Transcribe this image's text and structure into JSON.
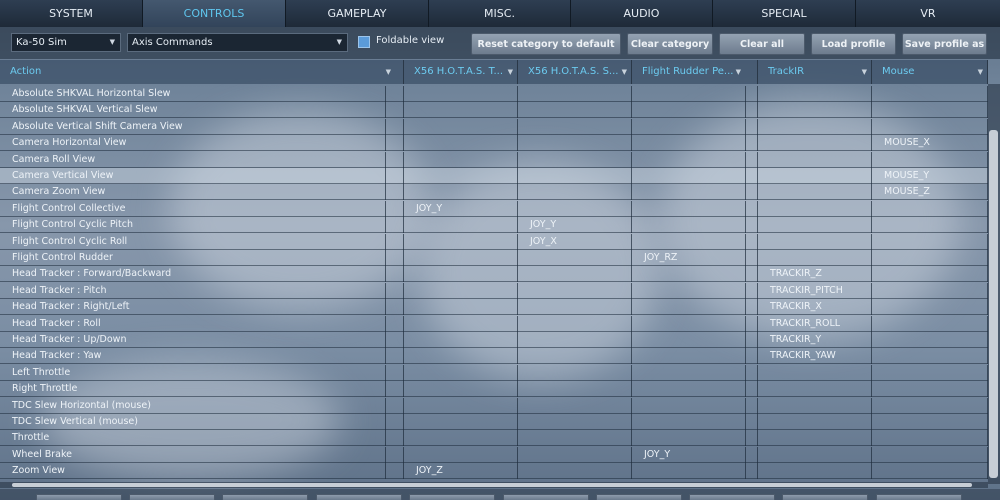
{
  "tabs": [
    {
      "label": "SYSTEM",
      "active": false
    },
    {
      "label": "CONTROLS",
      "active": true
    },
    {
      "label": "GAMEPLAY",
      "active": false
    },
    {
      "label": "MISC.",
      "active": false
    },
    {
      "label": "AUDIO",
      "active": false
    },
    {
      "label": "SPECIAL",
      "active": false
    },
    {
      "label": "VR",
      "active": false
    }
  ],
  "toolbar": {
    "aircraft_select": "Ka-50 Sim",
    "category_select": "Axis Commands",
    "foldable_label": "Foldable view",
    "foldable_checked": true,
    "reset_category_label": "Reset category to default",
    "clear_category_label": "Clear category",
    "clear_all_label": "Clear all",
    "load_profile_label": "Load profile",
    "save_profile_label": "Save profile as"
  },
  "columns": [
    "Action",
    "X56 H.O.T.A.S. T...",
    "X56 H.O.T.A.S. S...",
    "Flight Rudder Pe...",
    "TrackIR",
    "Mouse"
  ],
  "rows": [
    {
      "action": "Absolute SHKVAL Horizontal Slew",
      "c1": "",
      "c2": "",
      "c3": "",
      "c4": "",
      "c5": ""
    },
    {
      "action": "Absolute SHKVAL Vertical Slew",
      "c1": "",
      "c2": "",
      "c3": "",
      "c4": "",
      "c5": ""
    },
    {
      "action": "Absolute Vertical Shift Camera View",
      "c1": "",
      "c2": "",
      "c3": "",
      "c4": "",
      "c5": ""
    },
    {
      "action": "Camera Horizontal View",
      "c1": "",
      "c2": "",
      "c3": "",
      "c4": "",
      "c5": "MOUSE_X"
    },
    {
      "action": "Camera Roll View",
      "c1": "",
      "c2": "",
      "c3": "",
      "c4": "",
      "c5": ""
    },
    {
      "action": "Camera Vertical View",
      "c1": "",
      "c2": "",
      "c3": "",
      "c4": "",
      "c5": "MOUSE_Y",
      "selected": true
    },
    {
      "action": "Camera Zoom View",
      "c1": "",
      "c2": "",
      "c3": "",
      "c4": "",
      "c5": "MOUSE_Z"
    },
    {
      "action": "Flight Control Collective",
      "c1": "JOY_Y",
      "c2": "",
      "c3": "",
      "c4": "",
      "c5": ""
    },
    {
      "action": "Flight Control Cyclic Pitch",
      "c1": "",
      "c2": "JOY_Y",
      "c3": "",
      "c4": "",
      "c5": ""
    },
    {
      "action": "Flight Control Cyclic Roll",
      "c1": "",
      "c2": "JOY_X",
      "c3": "",
      "c4": "",
      "c5": ""
    },
    {
      "action": "Flight Control Rudder",
      "c1": "",
      "c2": "",
      "c3": "JOY_RZ",
      "c4": "",
      "c5": ""
    },
    {
      "action": "Head Tracker : Forward/Backward",
      "c1": "",
      "c2": "",
      "c3": "",
      "c4": "TRACKIR_Z",
      "c5": ""
    },
    {
      "action": "Head Tracker : Pitch",
      "c1": "",
      "c2": "",
      "c3": "",
      "c4": "TRACKIR_PITCH",
      "c5": ""
    },
    {
      "action": "Head Tracker : Right/Left",
      "c1": "",
      "c2": "",
      "c3": "",
      "c4": "TRACKIR_X",
      "c5": ""
    },
    {
      "action": "Head Tracker : Roll",
      "c1": "",
      "c2": "",
      "c3": "",
      "c4": "TRACKIR_ROLL",
      "c5": ""
    },
    {
      "action": "Head Tracker : Up/Down",
      "c1": "",
      "c2": "",
      "c3": "",
      "c4": "TRACKIR_Y",
      "c5": ""
    },
    {
      "action": "Head Tracker : Yaw",
      "c1": "",
      "c2": "",
      "c3": "",
      "c4": "TRACKIR_YAW",
      "c5": ""
    },
    {
      "action": "Left Throttle",
      "c1": "",
      "c2": "",
      "c3": "",
      "c4": "",
      "c5": ""
    },
    {
      "action": "Right Throttle",
      "c1": "",
      "c2": "",
      "c3": "",
      "c4": "",
      "c5": ""
    },
    {
      "action": "TDC Slew Horizontal (mouse)",
      "c1": "",
      "c2": "",
      "c3": "",
      "c4": "",
      "c5": ""
    },
    {
      "action": "TDC Slew Vertical (mouse)",
      "c1": "",
      "c2": "",
      "c3": "",
      "c4": "",
      "c5": ""
    },
    {
      "action": "Throttle",
      "c1": "",
      "c2": "",
      "c3": "",
      "c4": "",
      "c5": ""
    },
    {
      "action": "Wheel Brake",
      "c1": "",
      "c2": "",
      "c3": "JOY_Y",
      "c4": "",
      "c5": ""
    },
    {
      "action": "Zoom View",
      "c1": "JOY_Z",
      "c2": "",
      "c3": "",
      "c4": "",
      "c5": ""
    }
  ],
  "colors": {
    "accent": "#5fc6ee",
    "header_bg": "#2e3e52",
    "button": "#8a98a8"
  }
}
